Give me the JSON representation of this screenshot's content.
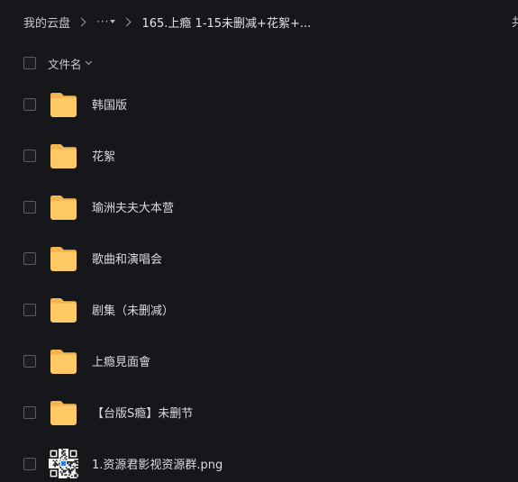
{
  "breadcrumb": {
    "root": "我的云盘",
    "more": "···",
    "current": "165.上瘾 1-15未删减+花絮+...",
    "right_clip": "共"
  },
  "header": {
    "sort_label": "文件名"
  },
  "files": [
    {
      "name": "韩国版",
      "type": "folder"
    },
    {
      "name": "花絮",
      "type": "folder"
    },
    {
      "name": "瑜洲夫夫大本营",
      "type": "folder"
    },
    {
      "name": "歌曲和演唱会",
      "type": "folder"
    },
    {
      "name": "剧集（未删减）",
      "type": "folder"
    },
    {
      "name": "上瘾見面會",
      "type": "folder"
    },
    {
      "name": "【台版S瘾】未删节",
      "type": "folder"
    },
    {
      "name": "1.资源君影视资源群.png",
      "type": "image"
    }
  ],
  "colors": {
    "background": "#16171b",
    "folder_front": "#ffc965",
    "folder_back": "#f4b54f"
  },
  "icons": {
    "folder": "folder-icon",
    "image": "qr-code-thumbnail",
    "separator": "chevron-right-icon",
    "sort": "chevron-down-icon"
  }
}
